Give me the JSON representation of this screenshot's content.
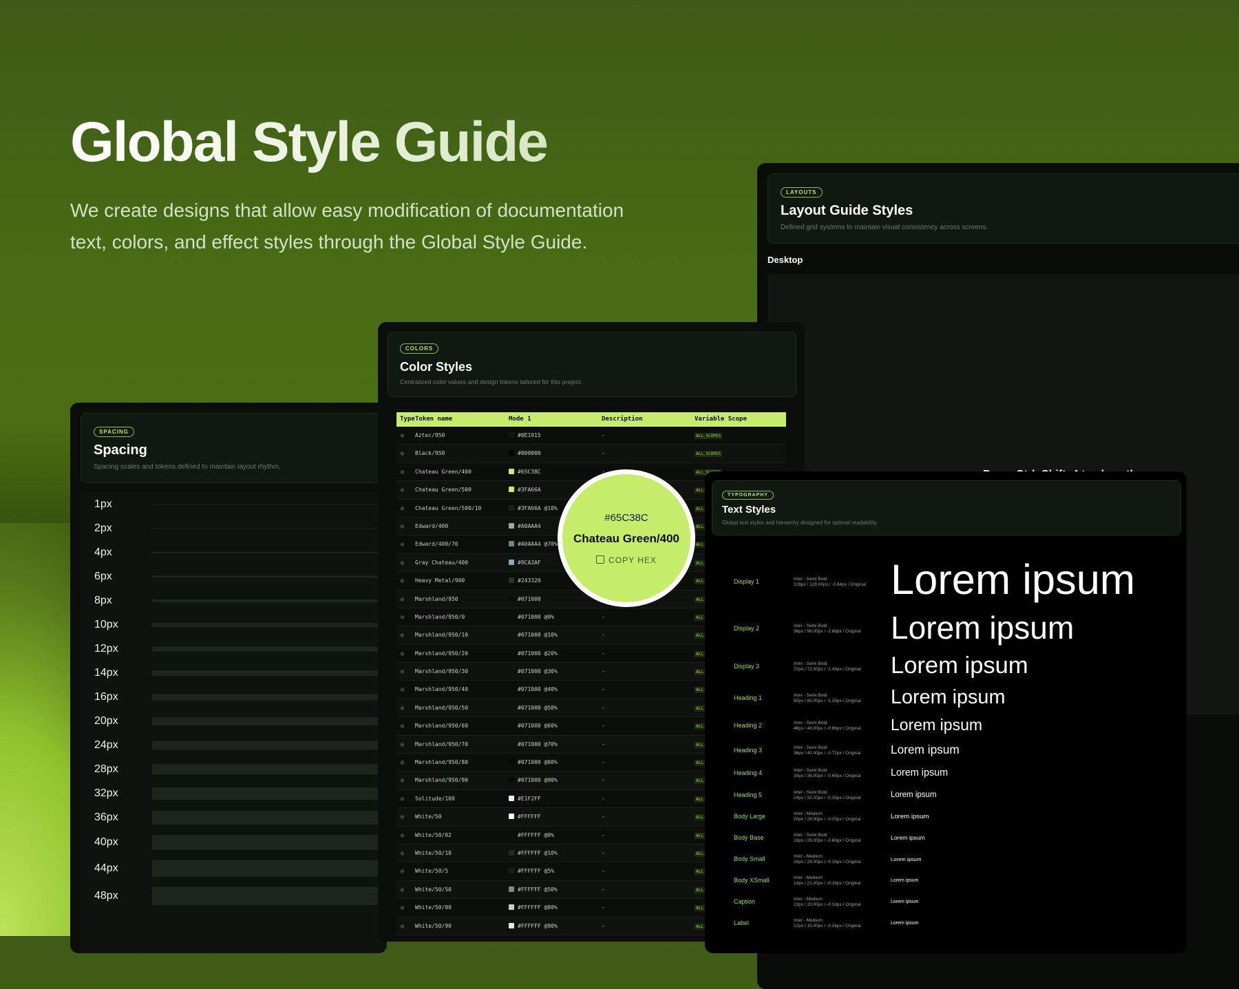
{
  "hero": {
    "title": "Global Style Guide",
    "description": "We create designs that allow easy modification of documentation text, colors, and effect styles through the Global Style Guide."
  },
  "layouts": {
    "badge": "LAYOUTS",
    "title": "Layout Guide Styles",
    "subtitle": "Defined grid systems to maintain visual consistency across screens.",
    "desktop_label": "Desktop",
    "partial_text": "Press Ctrl+Shift+4 to show the"
  },
  "colors": {
    "badge": "COLORS",
    "title": "Color Styles",
    "subtitle": "Centralized color values and design tokens tailored for this project.",
    "columns": [
      "Type",
      "Token name",
      "Mode 1",
      "Description",
      "Variable Scope"
    ],
    "rows": [
      {
        "token": "Aztec/950",
        "mode": "#0E1915",
        "swatch": "#0E1915",
        "desc": "-",
        "scope": "ALL_SCOPES"
      },
      {
        "token": "Black/950",
        "mode": "#000000",
        "swatch": "#000000",
        "desc": "-",
        "scope": "ALL_SCOPES"
      },
      {
        "token": "Chateau Green/400",
        "mode": "#65C38C",
        "swatch": "#c6ed6a",
        "desc": "-",
        "scope": "ALL_SCOPES"
      },
      {
        "token": "Chateau Green/500",
        "mode": "#3FA66A",
        "swatch": "#c6ed6a",
        "desc": "-",
        "scope": "ALL"
      },
      {
        "token": "Chateau Green/500/10",
        "mode": "#3FA66A @10%",
        "swatch": "#1a221a",
        "desc": "-",
        "scope": "ALL"
      },
      {
        "token": "Edward/400",
        "mode": "#A0AAA4",
        "swatch": "#A0AAA4",
        "desc": "-",
        "scope": "ALL"
      },
      {
        "token": "Edward/400/70",
        "mode": "#A0AAA4 @70%",
        "swatch": "#7a827d",
        "desc": "-",
        "scope": "ALL"
      },
      {
        "token": "Gray Chateau/400",
        "mode": "#9CA3AF",
        "swatch": "#9CA3AF",
        "desc": "-",
        "scope": "ALL"
      },
      {
        "token": "Heavy Metal/900",
        "mode": "#243320",
        "swatch": "#2a322a",
        "desc": "-",
        "scope": "ALL"
      },
      {
        "token": "Marshland/950",
        "mode": "#071000",
        "swatch": "#071000",
        "desc": "-",
        "scope": "ALL"
      },
      {
        "token": "Marshland/950/0",
        "mode": "#071000 @0%",
        "swatch": "",
        "desc": "-",
        "scope": "ALL"
      },
      {
        "token": "Marshland/950/10",
        "mode": "#071000 @10%",
        "swatch": "",
        "desc": "-",
        "scope": "ALL"
      },
      {
        "token": "Marshland/950/20",
        "mode": "#071000 @20%",
        "swatch": "",
        "desc": "-",
        "scope": "ALL"
      },
      {
        "token": "Marshland/950/30",
        "mode": "#071000 @30%",
        "swatch": "",
        "desc": "-",
        "scope": "ALL"
      },
      {
        "token": "Marshland/950/40",
        "mode": "#071000 @40%",
        "swatch": "",
        "desc": "-",
        "scope": "ALL"
      },
      {
        "token": "Marshland/950/50",
        "mode": "#071000 @50%",
        "swatch": "",
        "desc": "-",
        "scope": "ALL"
      },
      {
        "token": "Marshland/950/60",
        "mode": "#071000 @60%",
        "swatch": "",
        "desc": "-",
        "scope": "ALL"
      },
      {
        "token": "Marshland/950/70",
        "mode": "#071000 @70%",
        "swatch": "",
        "desc": "-",
        "scope": "ALL"
      },
      {
        "token": "Marshland/950/80",
        "mode": "#071000 @80%",
        "swatch": "#050a03",
        "desc": "-",
        "scope": "ALL"
      },
      {
        "token": "Marshland/950/90",
        "mode": "#071000 @90%",
        "swatch": "#050a03",
        "desc": "-",
        "scope": "ALL"
      },
      {
        "token": "Solitude/100",
        "mode": "#E1F2FF",
        "swatch": "#E1F2FF",
        "desc": "-",
        "scope": "ALL"
      },
      {
        "token": "White/50",
        "mode": "#FFFFFF",
        "swatch": "#FFFFFF",
        "desc": "-",
        "scope": "ALL"
      },
      {
        "token": "White/50/02",
        "mode": "#FFFFFF @0%",
        "swatch": "",
        "desc": "-",
        "scope": "ALL"
      },
      {
        "token": "White/50/10",
        "mode": "#FFFFFF @10%",
        "swatch": "#262a26",
        "desc": "-",
        "scope": "ALL"
      },
      {
        "token": "White/50/5",
        "mode": "#FFFFFF @5%",
        "swatch": "#1a1e1a",
        "desc": "-",
        "scope": "ALL"
      },
      {
        "token": "White/50/50",
        "mode": "#FFFFFF @50%",
        "swatch": "#888888",
        "desc": "-",
        "scope": "ALL"
      },
      {
        "token": "White/50/80",
        "mode": "#FFFFFF @80%",
        "swatch": "#cccccc",
        "desc": "-",
        "scope": "ALL"
      },
      {
        "token": "White/50/90",
        "mode": "#FFFFFF @90%",
        "swatch": "#e6e6e6",
        "desc": "-",
        "scope": "ALL"
      }
    ]
  },
  "popover": {
    "hex": "#65C38C",
    "name": "Chateau Green/400",
    "copy_label": "COPY HEX"
  },
  "spacing": {
    "badge": "SPACING",
    "title": "Spacing",
    "subtitle": "Spacing scales and tokens defined to maintain layout rhythm.",
    "items": [
      {
        "label": "1px",
        "value": 1
      },
      {
        "label": "2px",
        "value": 2
      },
      {
        "label": "4px",
        "value": 4
      },
      {
        "label": "6px",
        "value": 6
      },
      {
        "label": "8px",
        "value": 8
      },
      {
        "label": "10px",
        "value": 10
      },
      {
        "label": "12px",
        "value": 12
      },
      {
        "label": "14px",
        "value": 14
      },
      {
        "label": "16px",
        "value": 16
      },
      {
        "label": "20px",
        "value": 20
      },
      {
        "label": "24px",
        "value": 24
      },
      {
        "label": "28px",
        "value": 28
      },
      {
        "label": "32px",
        "value": 32
      },
      {
        "label": "36px",
        "value": 36
      },
      {
        "label": "40px",
        "value": 40
      },
      {
        "label": "44px",
        "value": 44
      },
      {
        "label": "48px",
        "value": 48
      }
    ]
  },
  "typography": {
    "badge": "TYPOGRAPHY",
    "title": "Text Styles",
    "subtitle": "Global text styles and hierarchy designed for optimal readability.",
    "sample": "Lorem ipsum",
    "styles": [
      {
        "name": "Display 1",
        "meta": "Inter - Semi Bold\n128px / 128.00px / -3.84px / Original",
        "size": 128
      },
      {
        "name": "Display 2",
        "meta": "Inter - Semi Bold\n96px / 96.00px / -2.88px / Original",
        "size": 96
      },
      {
        "name": "Display 3",
        "meta": "Inter - Semi Bold\n72px / 72.00px / -1.44px / Original",
        "size": 72
      },
      {
        "name": "Heading 1",
        "meta": "Inter - Semi Bold\n60px / 60.00px / -1.20px / Original",
        "size": 60
      },
      {
        "name": "Heading 2",
        "meta": "Inter - Semi Bold\n48px / 48.00px / -0.96px / Original",
        "size": 48
      },
      {
        "name": "Heading 3",
        "meta": "Inter - Semi Bold\n36px / 40.00px / -0.72px / Original",
        "size": 36
      },
      {
        "name": "Heading 4",
        "meta": "Inter - Semi Bold\n30px / 36.00px / -0.60px / Original",
        "size": 30
      },
      {
        "name": "Heading 5",
        "meta": "Inter - Semi Bold\n24px / 32.00px / -0.16px / Original",
        "size": 24
      },
      {
        "name": "Body Large",
        "meta": "Inter - Medium\n20px / 28.00px / -0.20px / Original",
        "size": 20
      },
      {
        "name": "Body Base",
        "meta": "Inter - Semi Bold\n18px / 28.00px / -0.60px / Original",
        "size": 18
      },
      {
        "name": "Body Small",
        "meta": "Inter - Medium\n16px / 24.00px / -0.16px / Original",
        "size": 16
      },
      {
        "name": "Body XSmall",
        "meta": "Inter - Medium\n14px / 21.00px / -0.16px / Original",
        "size": 14
      },
      {
        "name": "Caption",
        "meta": "Inter - Medium\n13px / 20.00px / -0.13px / Original",
        "size": 13
      },
      {
        "name": "Label",
        "meta": "Inter - Medium\n12px / 15.00px / -0.16px / Original",
        "size": 12
      }
    ]
  }
}
